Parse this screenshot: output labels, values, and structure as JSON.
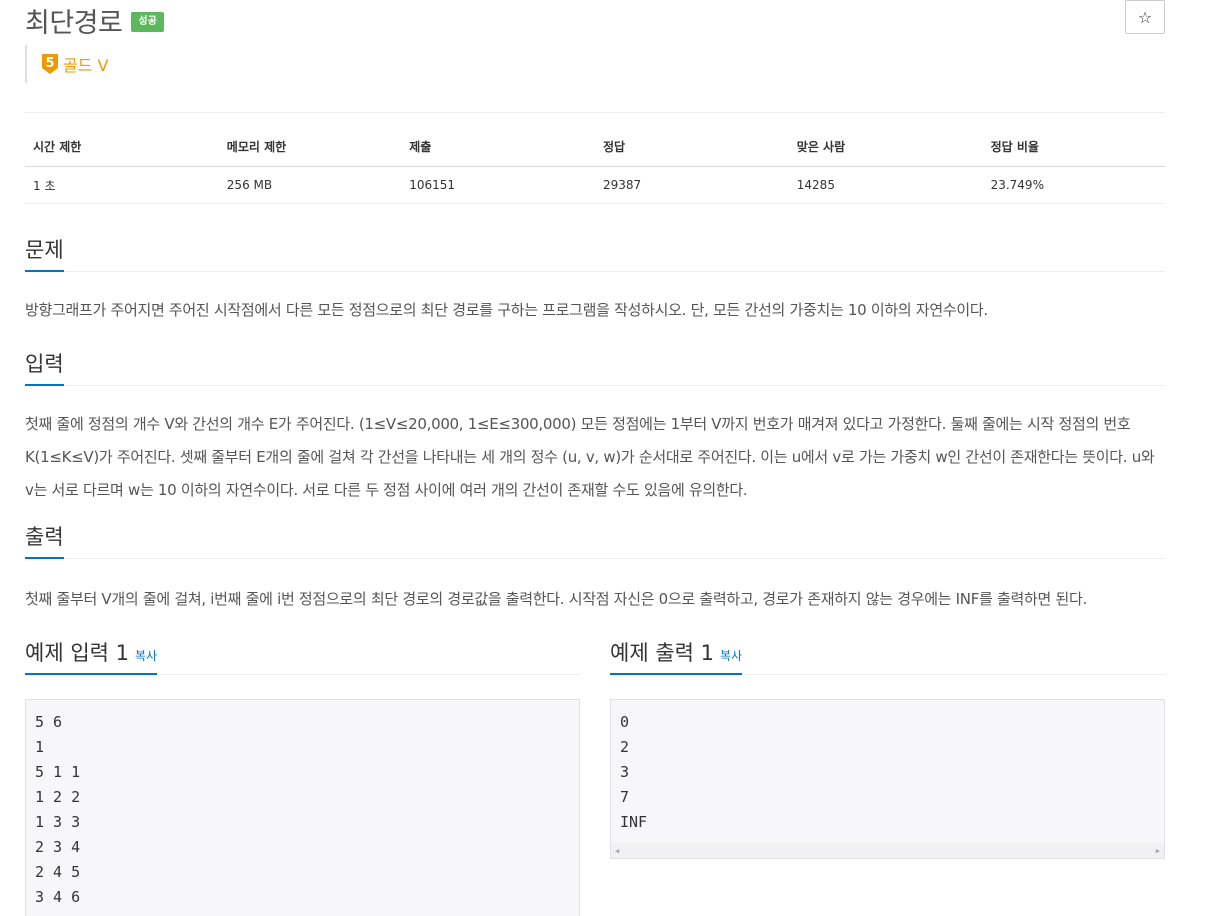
{
  "problem": {
    "title": "최단경로",
    "status_badge": "성공",
    "star_label": "☆",
    "tier": {
      "number": "5",
      "label": "골드 V",
      "color": "#ec9a00"
    }
  },
  "stats": {
    "headers": [
      "시간 제한",
      "메모리 제한",
      "제출",
      "정답",
      "맞은 사람",
      "정답 비율"
    ],
    "values": [
      "1 초",
      "256 MB",
      "106151",
      "29387",
      "14285",
      "23.749%"
    ]
  },
  "sections": {
    "problem": {
      "heading": "문제",
      "text": "방향그래프가 주어지면 주어진 시작점에서 다른 모든 정점으로의 최단 경로를 구하는 프로그램을 작성하시오. 단, 모든 간선의 가중치는 10 이하의 자연수이다."
    },
    "input": {
      "heading": "입력",
      "text": "첫째 줄에 정점의 개수 V와 간선의 개수 E가 주어진다. (1≤V≤20,000, 1≤E≤300,000) 모든 정점에는 1부터 V까지 번호가 매겨져 있다고 가정한다. 둘째 줄에는 시작 정점의 번호 K(1≤K≤V)가 주어진다. 셋째 줄부터 E개의 줄에 걸쳐 각 간선을 나타내는 세 개의 정수 (u, v, w)가 순서대로 주어진다. 이는 u에서 v로 가는 가중치 w인 간선이 존재한다는 뜻이다. u와 v는 서로 다르며 w는 10 이하의 자연수이다. 서로 다른 두 정점 사이에 여러 개의 간선이 존재할 수도 있음에 유의한다."
    },
    "output": {
      "heading": "출력",
      "text": "첫째 줄부터 V개의 줄에 걸쳐, i번째 줄에 i번 정점으로의 최단 경로의 경로값을 출력한다. 시작점 자신은 0으로 출력하고, 경로가 존재하지 않는 경우에는 INF를 출력하면 된다."
    }
  },
  "samples": {
    "input": {
      "heading": "예제 입력 1",
      "copy_label": "복사",
      "lines": [
        "5 6",
        "1",
        "5 1 1",
        "1 2 2",
        "1 3 3",
        "2 3 4",
        "2 4 5",
        "3 4 6"
      ]
    },
    "output": {
      "heading": "예제 출력 1",
      "copy_label": "복사",
      "lines": [
        "0",
        "2",
        "3",
        "7",
        "INF"
      ]
    }
  },
  "colors": {
    "accent": "#0076c0",
    "success": "#5cb85c"
  }
}
